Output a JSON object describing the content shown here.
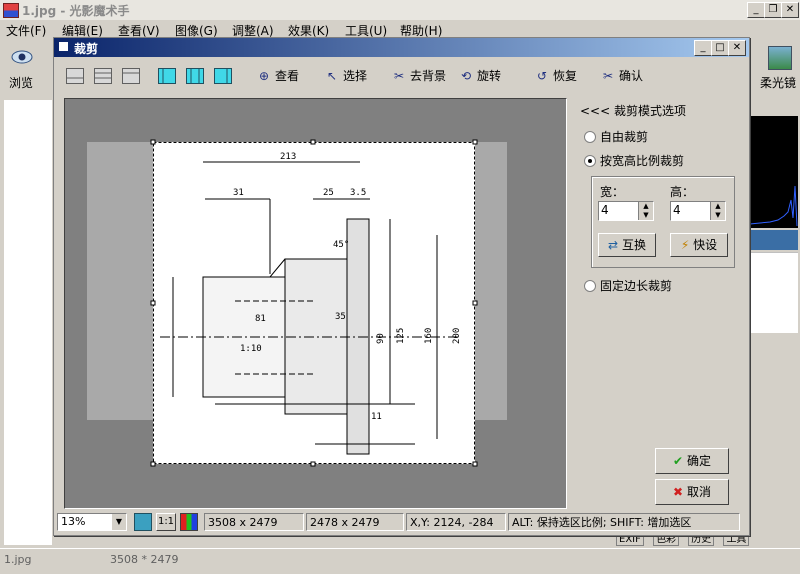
{
  "app": {
    "title": "1.jpg - 光影魔术手"
  },
  "menu": [
    "文件(F)",
    "编辑(E)",
    "查看(V)",
    "图像(G)",
    "调整(A)",
    "效果(K)",
    "工具(U)",
    "帮助(H)"
  ],
  "left_toolbar": {
    "browse_label": "浏览"
  },
  "right_toolbar": {
    "soft_focus_label": "柔光镜"
  },
  "right_tabs": [
    "EXIF",
    "色彩",
    "历史",
    "工具"
  ],
  "status": {
    "filename": "1.jpg",
    "dimensions": "3508 * 2479"
  },
  "dialog": {
    "title": "裁剪",
    "toolbar": {
      "view": "查看",
      "select": "选择",
      "remove_bg": "去背景",
      "rotate": "旋转",
      "restore": "恢复",
      "confirm": "确认"
    },
    "options": {
      "header": "<<< 裁剪模式选项",
      "free_crop": "自由裁剪",
      "ratio_crop": "按宽高比例裁剪",
      "width_label": "宽：",
      "height_label": "高：",
      "width_value": "4",
      "height_value": "4",
      "swap_button": "互换",
      "quick_button": "快设",
      "fixed_crop": "固定边长裁剪",
      "selected_mode": "ratio_crop"
    },
    "ok_button": "确定",
    "cancel_button": "取消",
    "statusbar": {
      "zoom": "13%",
      "one_to_one": "1:1",
      "image_size": "3508 x 2479",
      "selection_size": "2478 x 2479",
      "coords": "X,Y: 2124, -284",
      "hint": "ALT: 保持选区比例; SHIFT: 增加选区"
    }
  },
  "drawing_labels": {
    "top_dim": "213",
    "dim_a": "31",
    "dim_b": "25",
    "dim_c": "3.5",
    "dim_d": "35",
    "dim_e": "81",
    "taper": "1:10",
    "dia_a": "90",
    "dia_b": "125",
    "dia_c": "160",
    "dia_d": "200",
    "angle": "45°",
    "dim_f": "11"
  },
  "colors": {
    "dialog_title_start": "#0a246a",
    "dialog_title_end": "#a6caf0",
    "canvas_bg": "#808080"
  }
}
